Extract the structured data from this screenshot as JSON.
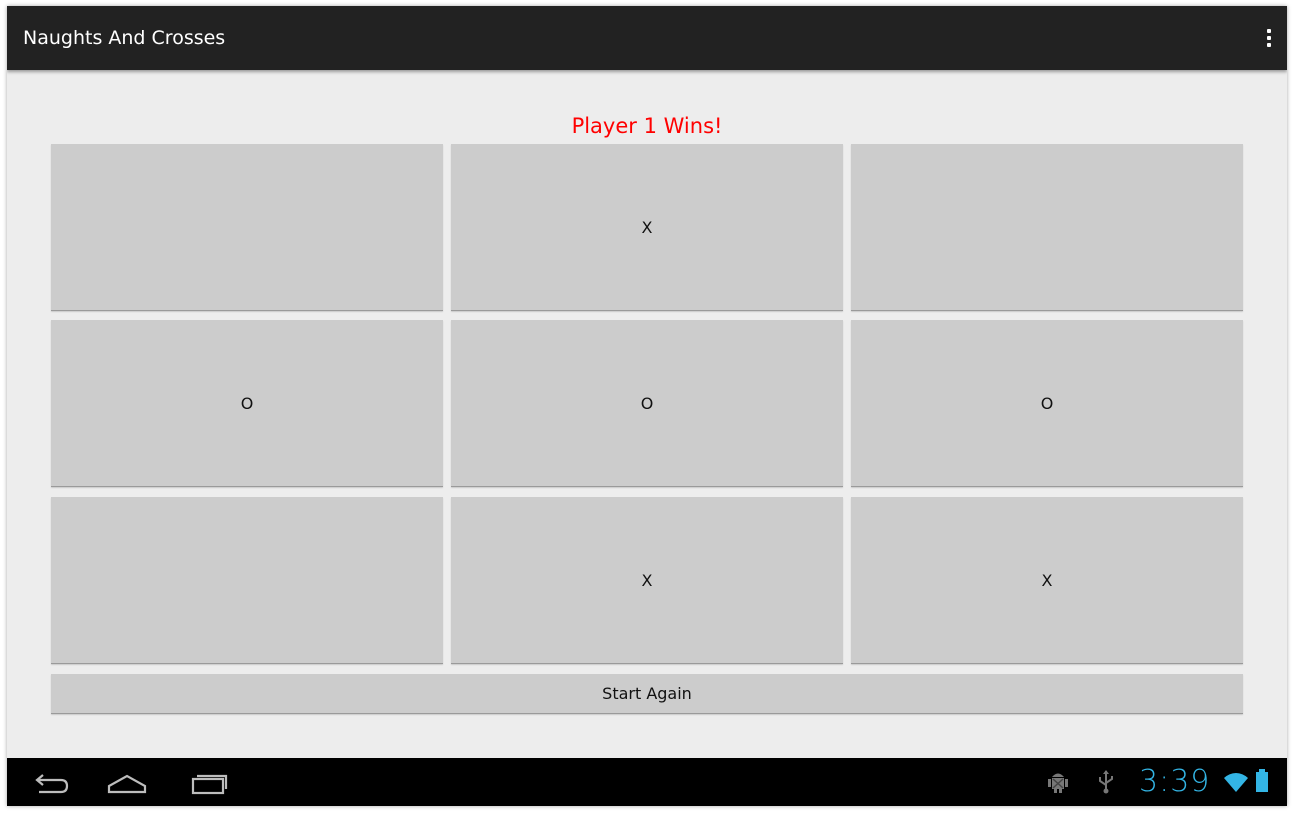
{
  "app": {
    "title": "Naughts And Crosses"
  },
  "game": {
    "status": "Player 1 Wins!",
    "board": [
      [
        "",
        "X",
        ""
      ],
      [
        "O",
        "O",
        "O"
      ],
      [
        "",
        "X",
        "X"
      ]
    ],
    "start_again_label": "Start Again"
  },
  "navbar": {
    "clock": "3:39",
    "icons": [
      "back-icon",
      "home-icon",
      "recent-apps-icon",
      "android-debug-icon",
      "usb-icon",
      "wifi-icon",
      "battery-icon"
    ]
  },
  "colors": {
    "action_bar": "#222222",
    "status_text": "#ff0000",
    "cell_background": "#cccccc",
    "content_background": "#ededed",
    "clock": "#33b5e5"
  }
}
